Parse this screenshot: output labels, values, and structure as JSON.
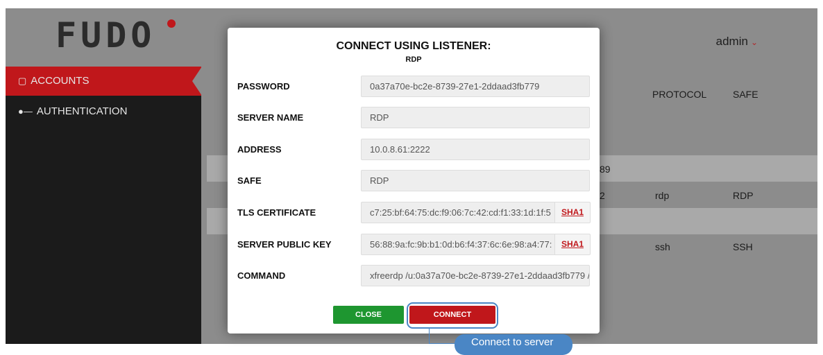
{
  "brand": {
    "logo": "FUDO",
    "accent": "#c0171b"
  },
  "header": {
    "user": "admin",
    "user_icon": "chevron-down-icon"
  },
  "sidebar": {
    "items": [
      {
        "label": "ACCOUNTS",
        "icon": "book-icon",
        "active": true
      },
      {
        "label": "AUTHENTICATION",
        "icon": "key-icon",
        "active": false
      }
    ]
  },
  "table": {
    "columns": [
      "PROTOCOL",
      "SAFE"
    ],
    "partial_cells": [
      "89",
      "2"
    ],
    "rows": [
      {
        "protocol": "rdp",
        "safe": "RDP"
      },
      {
        "protocol": "ssh",
        "safe": "SSH"
      }
    ]
  },
  "modal": {
    "title": "CONNECT USING LISTENER:",
    "subtitle": "RDP",
    "fields": [
      {
        "label": "PASSWORD",
        "value": "0a37a70e-bc2e-8739-27e1-2ddaad3fb779"
      },
      {
        "label": "SERVER NAME",
        "value": "RDP"
      },
      {
        "label": "ADDRESS",
        "value": "10.0.8.61:2222"
      },
      {
        "label": "SAFE",
        "value": "RDP"
      },
      {
        "label": "TLS CERTIFICATE",
        "value": "c7:25:bf:64:75:dc:f9:06:7c:42:cd:f1:33:1d:1f:5",
        "action": "SHA1"
      },
      {
        "label": "SERVER PUBLIC KEY",
        "value": "56:88:9a:fc:9b:b1:0d:b6:f4:37:6c:6e:98:a4:77:",
        "action": "SHA1"
      },
      {
        "label": "COMMAND",
        "value": "xfreerdp /u:0a37a70e-bc2e-8739-27e1-2ddaad3fb779 /"
      }
    ],
    "close_label": "CLOSE",
    "connect_label": "CONNECT"
  },
  "tooltip": {
    "text": "Connect to server"
  },
  "colors": {
    "success": "#1e9630",
    "danger": "#c0171b",
    "highlight": "#4a86c5"
  }
}
